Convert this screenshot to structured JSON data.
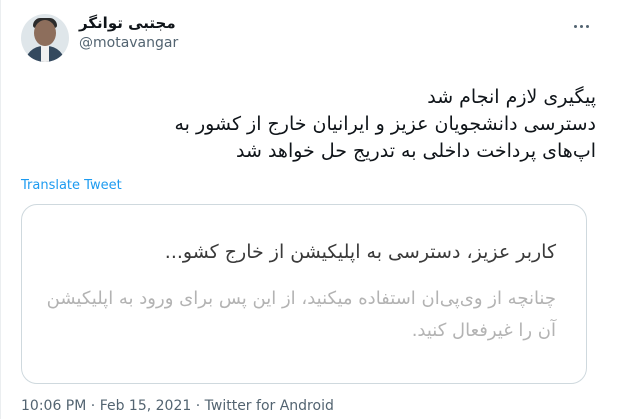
{
  "author": {
    "name": "مجتبی توانگر",
    "handle": "@motavangar"
  },
  "tweet": {
    "lines": [
      "پیگیری لازم انجام شد",
      "دسترسی دانشجویان عزیز و ایرانیان خارج از کشور به",
      "اپ‌های پرداخت داخلی به تدریج حل خواهد شد"
    ],
    "translate_label": "Translate Tweet"
  },
  "card": {
    "line1": "کاربر عزیز، دسترسی به اپلیکیشن       از خارج کشو...",
    "line2": "چنانچه از وی‌پی‌ان استفاده میکنید، از این پس برای ورود به اپلیکیشن آن را غیرفعال کنید."
  },
  "meta": {
    "time": "10:06 PM",
    "sep1": " · ",
    "date": "Feb 15, 2021",
    "sep2": " · ",
    "source": "Twitter for Android"
  }
}
